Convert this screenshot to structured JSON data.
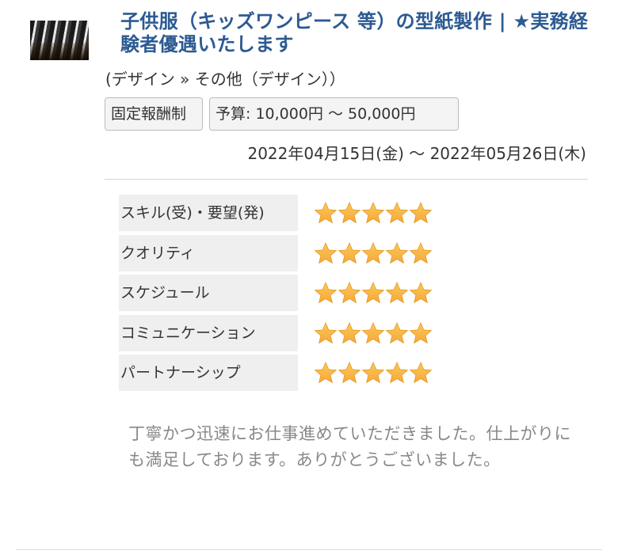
{
  "project": {
    "title": "子供服（キッズワンピース 等）の型紙製作 | ★実務経験者優遇いたします",
    "category": "(デザイン » その他（デザイン））",
    "payment_type": "固定報酬制",
    "budget": "予算: 10,000円 〜 50,000円",
    "period": "2022年04月15日(金) 〜 2022年05月26日(木)"
  },
  "ratings": [
    {
      "label": "スキル(受)・要望(発)",
      "stars": 5
    },
    {
      "label": "クオリティ",
      "stars": 5
    },
    {
      "label": "スケジュール",
      "stars": 5
    },
    {
      "label": "コミュニケーション",
      "stars": 5
    },
    {
      "label": "パートナーシップ",
      "stars": 5
    }
  ],
  "review": {
    "comment": "丁寧かつ迅速にお仕事進めていただきました。仕上がりにも満足しております。ありがとうございました。"
  },
  "colors": {
    "title": "#2c5a92",
    "star_fill": "#f4a93a",
    "label_bg": "#efefef",
    "comment_text": "#888888"
  }
}
